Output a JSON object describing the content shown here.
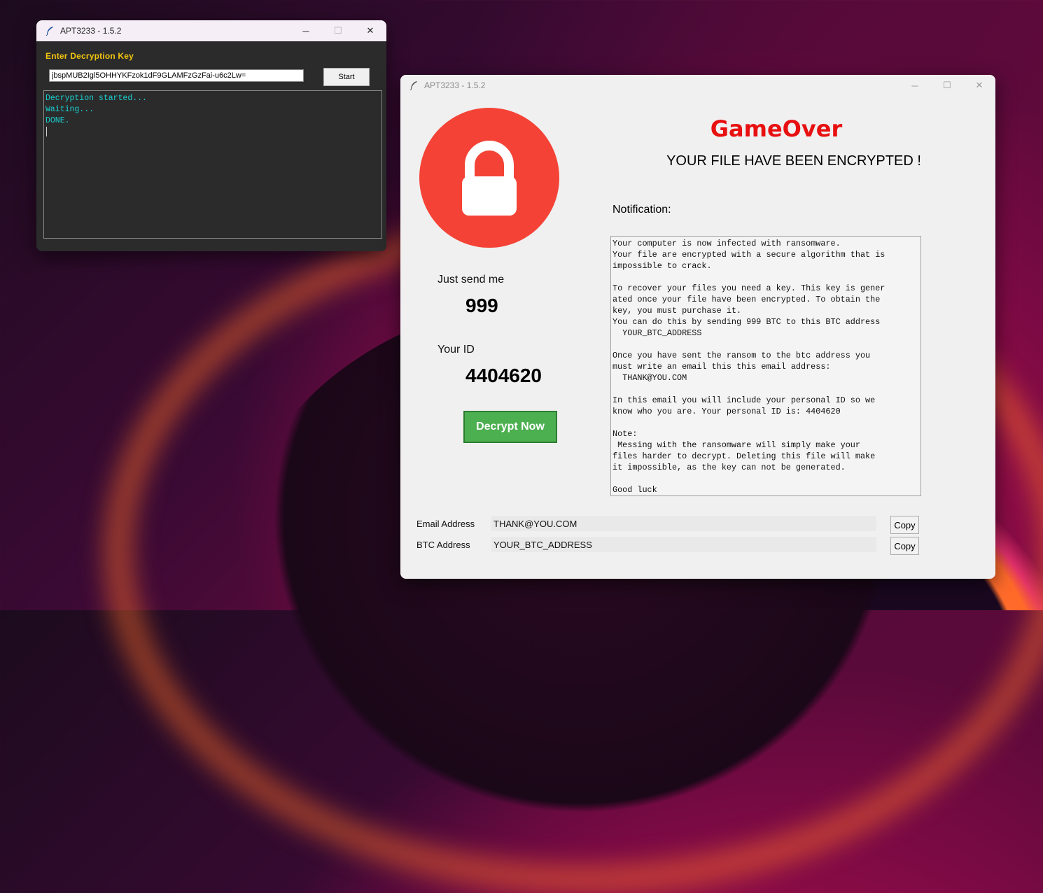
{
  "desktop": {
    "wallpaper": "Windows 11 bloom"
  },
  "decrypt_window": {
    "title": "APT3233 - 1.5.2",
    "label": "Enter Decryption Key",
    "key_value": "jbspMUB2Igl5OHHYKFzok1dF9GLAMFzGzFai-u6c2Lw=",
    "start_label": "Start",
    "console_lines": [
      "Decryption started...",
      "Waiting...",
      "DONE."
    ],
    "controls": {
      "minimize": "─",
      "maximize": "☐",
      "close": "✕"
    }
  },
  "ransom_window": {
    "title": "APT3233 - 1.5.2",
    "heading": "GameOver",
    "subheading": "YOUR FILE HAVE BEEN ENCRYPTED !",
    "notification_label": "Notification:",
    "note_text": "Your computer is now infected with ransomware.\nYour file are encrypted with a secure algorithm that is\nimpossible to crack.\n\nTo recover your files you need a key. This key is gener\nated once your file have been encrypted. To obtain the\nkey, you must purchase it.\nYou can do this by sending 999 BTC to this BTC address\n  YOUR_BTC_ADDRESS\n\nOnce you have sent the ransom to the btc address you\nmust write an email this this email address:\n  THANK@YOU.COM\n\nIn this email you will include your personal ID so we\nknow who you are. Your personal ID is: 4404620\n\nNote:\n Messing with the ransomware will simply make your\nfiles harder to decrypt. Deleting this file will make\nit impossible, as the key can not be generated.\n\nGood luck",
    "send_label": "Just send me",
    "amount": "999",
    "id_label": "Your ID",
    "id_value": "4404620",
    "decrypt_label": "Decrypt Now",
    "email_label": "Email Address",
    "email_value": "THANK@YOU.COM",
    "btc_label": "BTC Address",
    "btc_value": "YOUR_BTC_ADDRESS",
    "copy_label": "Copy",
    "controls": {
      "minimize": "─",
      "maximize": "☐",
      "close": "✕"
    },
    "colors": {
      "lock_circle": "#f44336",
      "heading": "#e81010",
      "decrypt_button": "#4caf50"
    }
  }
}
